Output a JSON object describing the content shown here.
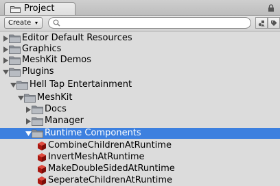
{
  "tab": {
    "title": "Project"
  },
  "toolbar": {
    "create_label": "Create",
    "create_arrow": "▾",
    "search_value": ""
  },
  "tree": [
    {
      "label": "Editor Default Resources",
      "type": "folder",
      "expanded": false
    },
    {
      "label": "Graphics",
      "type": "folder",
      "expanded": false
    },
    {
      "label": "MeshKit Demos",
      "type": "folder",
      "expanded": false
    },
    {
      "label": "Plugins",
      "type": "folder",
      "expanded": true
    },
    {
      "label": "Hell Tap Entertainment",
      "type": "folder",
      "expanded": true
    },
    {
      "label": "MeshKit",
      "type": "folder",
      "expanded": true
    },
    {
      "label": "Docs",
      "type": "folder",
      "expanded": false
    },
    {
      "label": "Manager",
      "type": "folder",
      "expanded": false
    },
    {
      "label": "Runtime Components",
      "type": "folder",
      "expanded": true,
      "selected": true
    },
    {
      "label": "CombineChildrenAtRuntime",
      "type": "script"
    },
    {
      "label": "InvertMeshAtRuntime",
      "type": "script"
    },
    {
      "label": "MakeDoubleSidedAtRuntime",
      "type": "script"
    },
    {
      "label": "SeperateChildrenAtRuntime",
      "type": "script"
    }
  ],
  "colors": {
    "selection": "#3d80df",
    "folder": "#b8bcc2",
    "script_icon": "#c0201c"
  },
  "icons": [
    "folder-icon",
    "script-cube-icon",
    "search-icon",
    "lock-icon",
    "filter-type-icon",
    "filter-label-icon"
  ]
}
